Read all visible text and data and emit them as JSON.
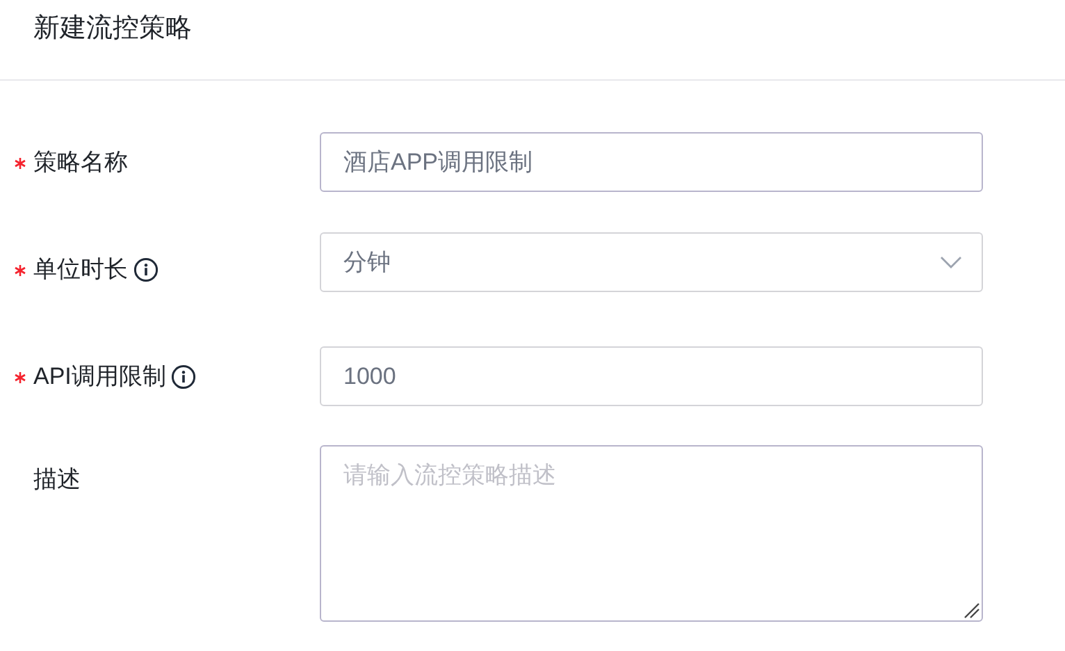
{
  "title": "新建流控策略",
  "fields": [
    {
      "kind": "text",
      "label": "策略名称",
      "required": true,
      "info": false,
      "value": "酒店APP调用限制"
    },
    {
      "kind": "select",
      "label": "单位时长",
      "required": true,
      "info": true,
      "value": "分钟"
    },
    {
      "kind": "text",
      "label": "API调用限制",
      "required": true,
      "info": true,
      "value": "1000"
    },
    {
      "kind": "textarea",
      "label": "描述",
      "required": false,
      "info": false,
      "placeholder": "请输入流控策略描述"
    }
  ]
}
